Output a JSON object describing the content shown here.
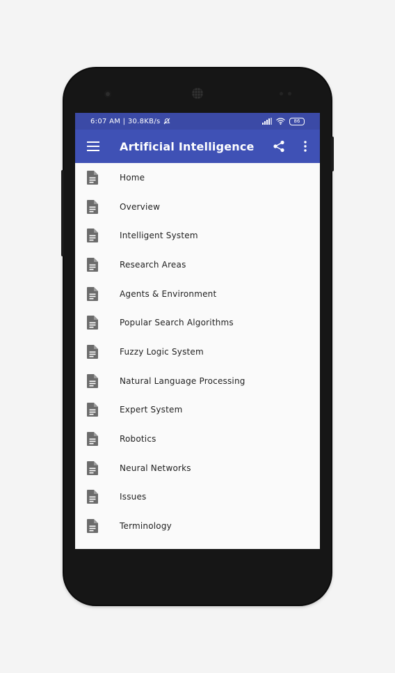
{
  "status_bar": {
    "time_speed": "6:07 AM | 30.8KB/s",
    "battery": "86",
    "icons": [
      "mute-icon",
      "signal-icon",
      "wifi-icon",
      "battery-icon"
    ]
  },
  "app_bar": {
    "title": "Artificial Intelligence",
    "icons": [
      "menu-icon",
      "share-icon",
      "more-vert-icon"
    ],
    "color": "#3f51b5"
  },
  "menu": {
    "icon": "document-icon",
    "items": [
      {
        "label": "Home"
      },
      {
        "label": "Overview"
      },
      {
        "label": "Intelligent System"
      },
      {
        "label": "Research Areas"
      },
      {
        "label": "Agents & Environment"
      },
      {
        "label": "Popular Search Algorithms"
      },
      {
        "label": "Fuzzy Logic System"
      },
      {
        "label": "Natural Language Processing"
      },
      {
        "label": "Expert System"
      },
      {
        "label": "Robotics"
      },
      {
        "label": "Neural Networks"
      },
      {
        "label": "Issues"
      },
      {
        "label": "Terminology"
      }
    ]
  }
}
